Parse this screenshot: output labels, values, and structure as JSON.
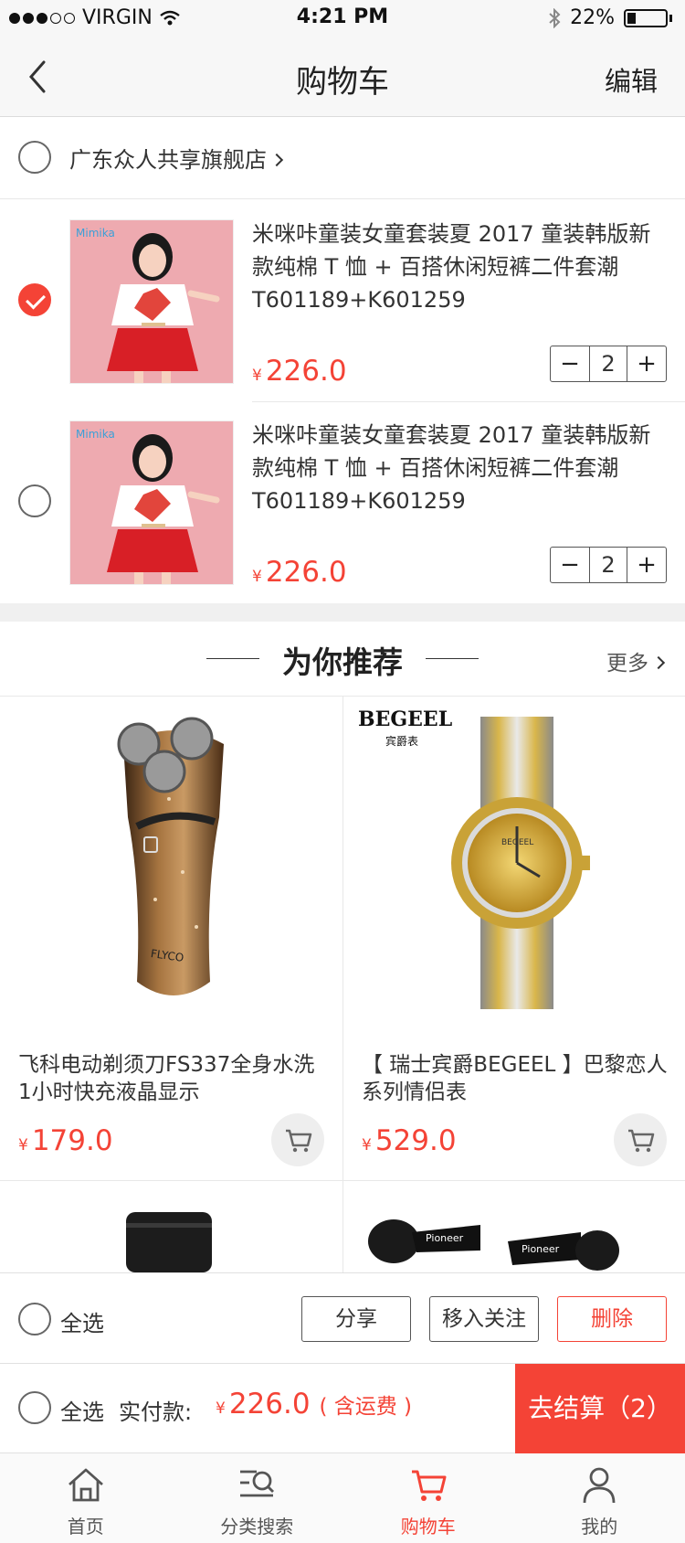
{
  "status_bar": {
    "carrier": "VIRGIN",
    "time": "4:21 PM",
    "battery": "22%",
    "battery_level": 0.22
  },
  "nav": {
    "title": "购物车",
    "edit_label": "编辑"
  },
  "shop": {
    "name": "广东众人共享旗舰店"
  },
  "cart_items": [
    {
      "title": "米咪咔童装女童套装夏 2017 童装韩版新款纯棉 T 恤 + 百搭休闲短裤二件套潮 T601189+K601259",
      "currency": "¥",
      "price": "226.0",
      "quantity": "2",
      "checked": true
    },
    {
      "title": "米咪咔童装女童套装夏 2017 童装韩版新款纯棉 T 恤 + 百搭休闲短裤二件套潮 T601189+K601259",
      "currency": "¥",
      "price": "226.0",
      "quantity": "2",
      "checked": false
    }
  ],
  "stepper": {
    "minus": "−",
    "plus": "+"
  },
  "recommend": {
    "title": "为你推荐",
    "more_label": "更多"
  },
  "products": [
    {
      "name": "飞科电动剃须刀FS337全身水洗1小时快充液晶显示",
      "currency": "¥",
      "price": "179.0"
    },
    {
      "name": "【 瑞士宾爵BEGEEL 】巴黎恋人系列情侣表",
      "currency": "¥",
      "price": "529.0",
      "brand": "BEGEEL",
      "brand_cn": "宾爵表"
    }
  ],
  "action_bar": {
    "select_all": "全选",
    "share": "分享",
    "follow": "移入关注",
    "delete": "删除"
  },
  "pay_bar": {
    "select_all": "全选",
    "label": "实付款:",
    "currency": "¥",
    "total": "226.0",
    "note": "( 含运费 )",
    "checkout": "去结算（2）"
  },
  "tabs": [
    {
      "label": "首页",
      "icon": "home-icon"
    },
    {
      "label": "分类搜索",
      "icon": "category-search-icon"
    },
    {
      "label": "购物车",
      "icon": "cart-icon",
      "active": true
    },
    {
      "label": "我的",
      "icon": "user-icon"
    }
  ],
  "colors": {
    "accent": "#f44336",
    "bar_bg": "#f7f7f7"
  }
}
